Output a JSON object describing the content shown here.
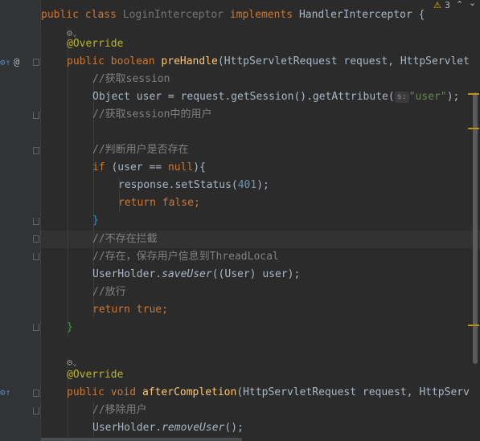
{
  "code": {
    "l1": {
      "kw1": "public",
      "kw2": "class",
      "name": "LoginInterceptor",
      "kw3": "implements",
      "iface": "HandlerInterceptor",
      "brace": "{"
    },
    "l2": {
      "icon": "⚙"
    },
    "l3": {
      "annotation": "@Override"
    },
    "l4": {
      "kw1": "public",
      "kw2": "boolean",
      "method": "preHandle",
      "params": "(HttpServletRequest request, HttpServlet"
    },
    "l5": {
      "comment": "//获取session"
    },
    "l6": {
      "a": "Object user = request.getSession().getAttribute(",
      "hint": "s:",
      "str": "\"user\"",
      "end": ");"
    },
    "l7": {
      "comment": "//获取session中的用户"
    },
    "l9": {
      "comment": "//判断用户是否存在"
    },
    "l10": {
      "kw": "if",
      "a": " (user == ",
      "null": "null",
      "b": "){"
    },
    "l11": {
      "a": "response.setStatus(",
      "num": "401",
      "b": ");"
    },
    "l12": {
      "kw1": "return",
      "kw2": "false",
      "end": ";"
    },
    "l13": {
      "brace": "}"
    },
    "l14": {
      "comment": "//不存在拦截"
    },
    "l15": {
      "comment": "//存在，保存用户信息到ThreadLocal"
    },
    "l16": {
      "a": "UserHolder.",
      "method": "saveUser",
      "b": "((User) user);"
    },
    "l17": {
      "comment": "//放行"
    },
    "l18": {
      "kw1": "return",
      "kw2": "true",
      "end": ";"
    },
    "l19": {
      "brace": "}"
    },
    "l21": {
      "icon": "⚙"
    },
    "l22": {
      "annotation": "@Override"
    },
    "l23": {
      "kw1": "public",
      "kw2": "void",
      "method": "afterCompletion",
      "params": "(HttpServletRequest request, HttpServ"
    },
    "l24": {
      "comment": "//移除用户"
    },
    "l25": {
      "a": "UserHolder.",
      "method": "removeUser",
      "b": "();"
    }
  },
  "inspections": {
    "warning_count": "3"
  },
  "colors": {
    "background": "#2b2b2b",
    "keyword": "#cc7832",
    "method": "#ffc66d",
    "comment": "#808080",
    "annotation": "#bbb529",
    "string": "#6a8759",
    "number": "#6897bb"
  }
}
